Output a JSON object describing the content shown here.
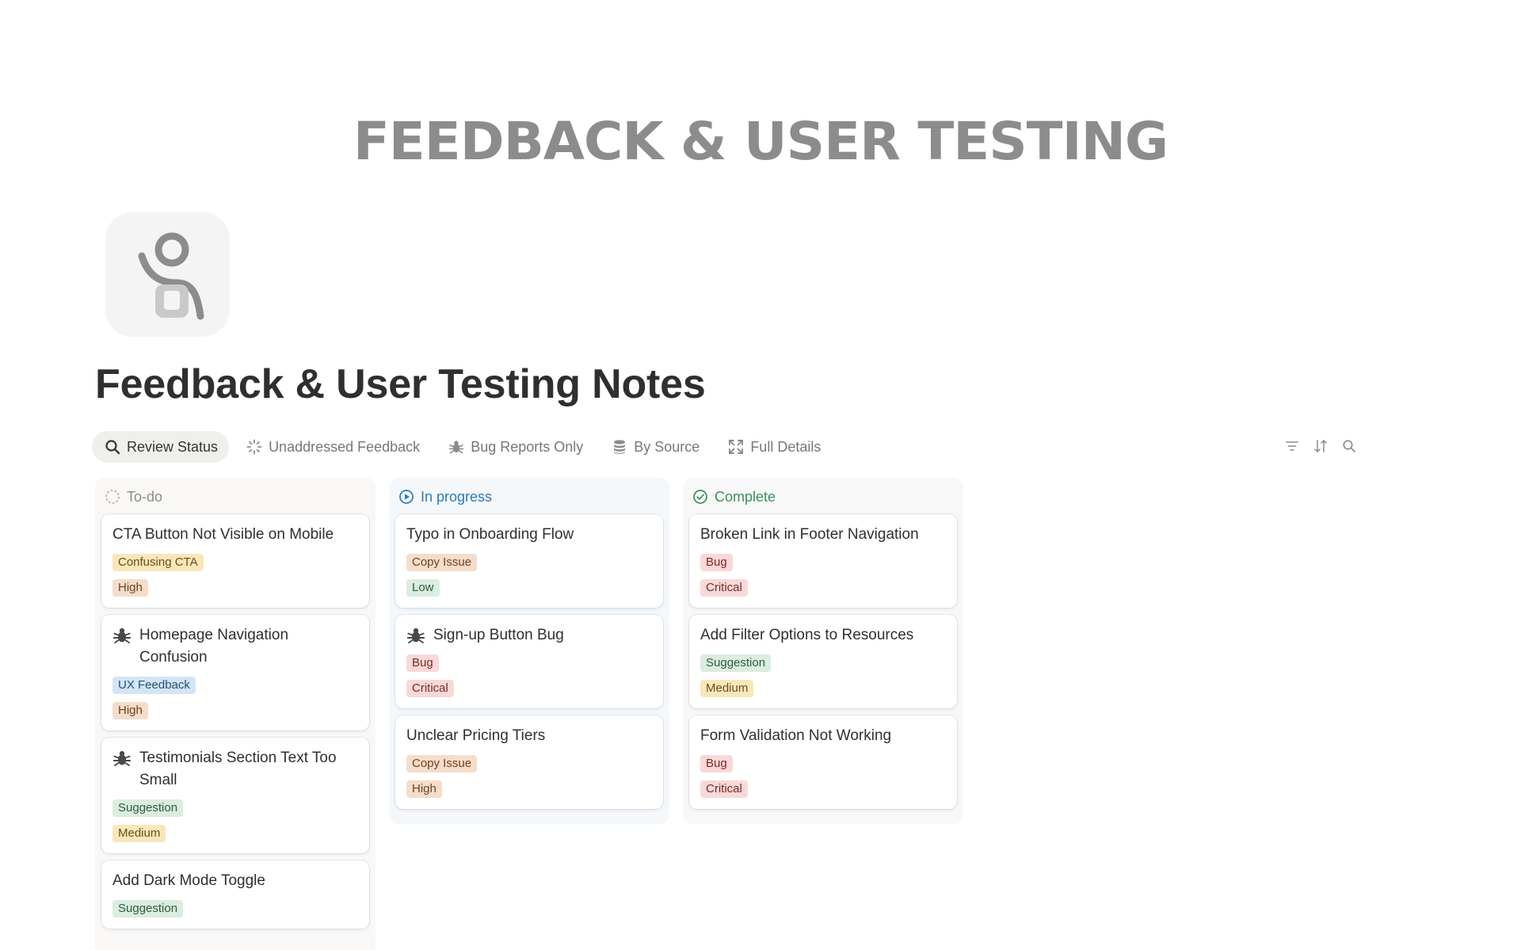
{
  "banner": {
    "title": "FEEDBACK & USER TESTING"
  },
  "page": {
    "title": "Feedback & User Testing Notes",
    "icon": "person-waving-icon"
  },
  "views": [
    {
      "label": "Review Status",
      "icon": "search-icon",
      "active": true
    },
    {
      "label": "Unaddressed Feedback",
      "icon": "loading-icon"
    },
    {
      "label": "Bug Reports Only",
      "icon": "bug-icon"
    },
    {
      "label": "By Source",
      "icon": "database-icon"
    },
    {
      "label": "Full Details",
      "icon": "expand-icon"
    }
  ],
  "toolbar": [
    "filter-icon",
    "sort-icon",
    "search-icon"
  ],
  "tag_colors": {
    "Confusing CTA": {
      "bg": "#f8e7ba",
      "fg": "#6b4f12"
    },
    "UX Feedback": {
      "bg": "#d3e5f4",
      "fg": "#23517a"
    },
    "Suggestion": {
      "bg": "#dbece0",
      "fg": "#2f5b3c"
    },
    "Copy Issue": {
      "bg": "#f5ddcb",
      "fg": "#70421e"
    },
    "Bug": {
      "bg": "#f8d9d7",
      "fg": "#7a2a26"
    },
    "High": {
      "bg": "#f5ddcb",
      "fg": "#70421e"
    },
    "Medium": {
      "bg": "#f8e7ba",
      "fg": "#6b4f12"
    },
    "Low": {
      "bg": "#dbece0",
      "fg": "#2f5b3c"
    },
    "Critical": {
      "bg": "#f8d9d7",
      "fg": "#7a2a26"
    }
  },
  "columns": [
    {
      "label": "To-do",
      "cards": [
        {
          "title": "CTA Button Not Visible on Mobile",
          "bug": false,
          "type": "Confusing CTA",
          "priority": "High"
        },
        {
          "title": "Homepage Navigation Confusion",
          "bug": true,
          "type": "UX Feedback",
          "priority": "High"
        },
        {
          "title": "Testimonials Section Text Too Small",
          "bug": true,
          "type": "Suggestion",
          "priority": "Medium"
        },
        {
          "title": "Add Dark Mode Toggle",
          "bug": false,
          "type": "Suggestion",
          "priority": ""
        }
      ]
    },
    {
      "label": "In progress",
      "cards": [
        {
          "title": "Typo in Onboarding Flow",
          "bug": false,
          "type": "Copy Issue",
          "priority": "Low"
        },
        {
          "title": "Sign-up Button Bug",
          "bug": true,
          "type": "Bug",
          "priority": "Critical"
        },
        {
          "title": "Unclear Pricing Tiers",
          "bug": false,
          "type": "Copy Issue",
          "priority": "High"
        }
      ]
    },
    {
      "label": "Complete",
      "cards": [
        {
          "title": "Broken Link in Footer Navigation",
          "bug": false,
          "type": "Bug",
          "priority": "Critical"
        },
        {
          "title": "Add Filter Options to Resources",
          "bug": false,
          "type": "Suggestion",
          "priority": "Medium"
        },
        {
          "title": "Form Validation Not Working",
          "bug": false,
          "type": "Bug",
          "priority": "Critical"
        }
      ]
    }
  ]
}
